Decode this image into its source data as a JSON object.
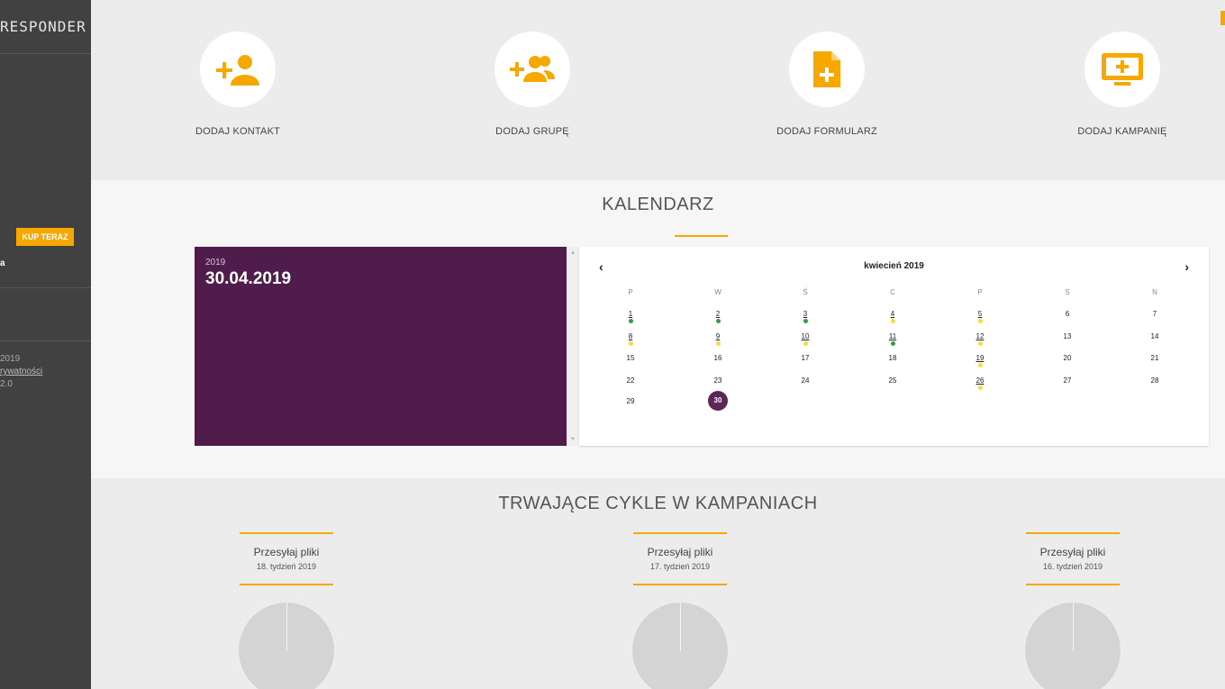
{
  "sidebar": {
    "brand": "RESPONDER",
    "buy_button": "KUP TERAZ",
    "user": "a",
    "footer_year": "2019",
    "footer_link": "rywatności",
    "footer_version": "2.0"
  },
  "actions": [
    {
      "label": "DODAJ KONTAKT",
      "icon": "add-contact-icon"
    },
    {
      "label": "DODAJ GRUPĘ",
      "icon": "add-group-icon"
    },
    {
      "label": "DODAJ FORMULARZ",
      "icon": "add-form-icon"
    },
    {
      "label": "DODAJ KAMPANIĘ",
      "icon": "add-campaign-icon"
    }
  ],
  "calendar": {
    "title": "KALENDARZ",
    "selected_year": "2019",
    "selected_date": "30.04.2019",
    "month_label": "kwiecień 2019",
    "prev": "‹",
    "next": "›",
    "weekdays": [
      "P",
      "W",
      "Ś",
      "C",
      "P",
      "S",
      "N"
    ],
    "days": [
      {
        "d": "1",
        "dot": "green",
        "u": true
      },
      {
        "d": "2",
        "dot": "green",
        "u": true
      },
      {
        "d": "3",
        "dot": "green",
        "u": true
      },
      {
        "d": "4",
        "dot": "yellow",
        "u": true
      },
      {
        "d": "5",
        "dot": "yellow",
        "u": true
      },
      {
        "d": "6"
      },
      {
        "d": "7"
      },
      {
        "d": "8",
        "dot": "yellow",
        "u": true
      },
      {
        "d": "9",
        "dot": "yellow",
        "u": true
      },
      {
        "d": "10",
        "dot": "yellow",
        "u": true
      },
      {
        "d": "11",
        "dot": "green",
        "u": true
      },
      {
        "d": "12",
        "dot": "yellow",
        "u": true
      },
      {
        "d": "13"
      },
      {
        "d": "14"
      },
      {
        "d": "15"
      },
      {
        "d": "16"
      },
      {
        "d": "17"
      },
      {
        "d": "18"
      },
      {
        "d": "19",
        "dot": "yellow",
        "u": true
      },
      {
        "d": "20"
      },
      {
        "d": "21"
      },
      {
        "d": "22"
      },
      {
        "d": "23"
      },
      {
        "d": "24"
      },
      {
        "d": "25"
      },
      {
        "d": "26",
        "dot": "yellow",
        "u": true
      },
      {
        "d": "27"
      },
      {
        "d": "28"
      },
      {
        "d": "29"
      },
      {
        "d": "30",
        "selected": true
      }
    ],
    "colors": {
      "green": "#2e9e4a",
      "yellow": "#f2e03a",
      "selected": "#5a2757",
      "panel": "#4f1c4b",
      "accent": "#f6a800"
    }
  },
  "cycles": {
    "title": "TRWAJĄCE CYKLE W KAMPANIACH",
    "items": [
      {
        "name": "Przesyłaj pliki",
        "week": "18. tydzień 2019"
      },
      {
        "name": "Przesyłaj pliki",
        "week": "17. tydzień 2019"
      },
      {
        "name": "Przesyłaj pliki",
        "week": "16. tydzień 2019"
      }
    ]
  }
}
